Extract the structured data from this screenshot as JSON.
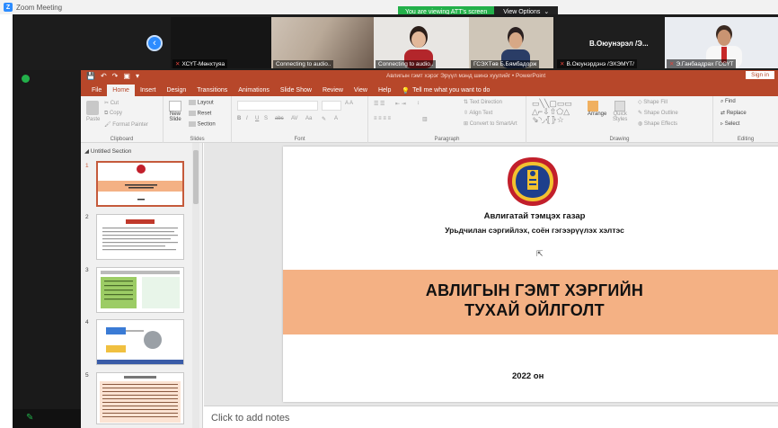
{
  "zoom": {
    "window_title": "Zoom Meeting",
    "share_banner": "You are viewing ATT's screen",
    "view_options": "View Options",
    "view_options_caret": "⌄"
  },
  "participants": [
    {
      "name": "ХСҮТ-Мөнхтуяа"
    },
    {
      "name": "Connecting to audio.."
    },
    {
      "name": "Connecting to audio.."
    },
    {
      "name": "ГСЭХТөв Б.Бямбадорж"
    },
    {
      "name": "В.Оюунэрдэнэ /ЭХЭМҮТ/"
    },
    {
      "name": "Э.Ганбаадрах ГССҮТ"
    }
  ],
  "featured_name": "В.Оюунэрэл /Э...",
  "ppt": {
    "quick_access": [
      "💾",
      "↶",
      "↷",
      "▣",
      "▾"
    ],
    "title": "Авлигын гэмт хэрэг Эрүүл мэнд шинэ хуулийг • PowerPoint",
    "signin": "Sign in",
    "tabs": [
      "File",
      "Home",
      "Insert",
      "Design",
      "Transitions",
      "Animations",
      "Slide Show",
      "Review",
      "View",
      "Help"
    ],
    "active_tab": "Home",
    "tell_me": "Tell me what you want to do",
    "ribbon": {
      "clipboard": {
        "label": "Clipboard",
        "paste": "Paste",
        "cut": "Cut",
        "copy": "Copy",
        "format_painter": "Format Painter"
      },
      "slides": {
        "label": "Slides",
        "new_slide": "New",
        "new_slide2": "Slide",
        "layout": "Layout",
        "reset": "Reset",
        "section": "Section"
      },
      "font": {
        "label": "Font"
      },
      "paragraph": {
        "label": "Paragraph",
        "text_direction": "Text Direction",
        "align_text": "Align Text",
        "convert": "Convert to SmartArt"
      },
      "drawing": {
        "label": "Drawing",
        "arrange": "Arrange",
        "quick_styles": "Quick",
        "quick_styles2": "Styles",
        "shape_fill": "Shape Fill",
        "shape_outline": "Shape Outline",
        "shape_effects": "Shape Effects"
      },
      "editing": {
        "label": "Editing",
        "find": "Find",
        "replace": "Replace",
        "select": "Select"
      }
    },
    "section_name": "Untitled Section",
    "slide_numbers": [
      "1",
      "2",
      "3",
      "4",
      "5"
    ],
    "slide": {
      "org": "Авлигатай тэмцэх газар",
      "dept": "Урьдчилан сэргийлэх, соён гэгээрүүлэх хэлтэс",
      "title_line1": "АВЛИГЫН ГЭМТ ХЭРГИЙН",
      "title_line2": "ТУХАЙ ОЙЛГОЛТ",
      "year": "2022 он"
    },
    "notes_placeholder": "Click to add notes"
  },
  "colors": {
    "ppt_accent": "#b7472a",
    "band": "#f4b184",
    "zoom_blue": "#2d8cff",
    "zoom_green": "#23b04a"
  }
}
